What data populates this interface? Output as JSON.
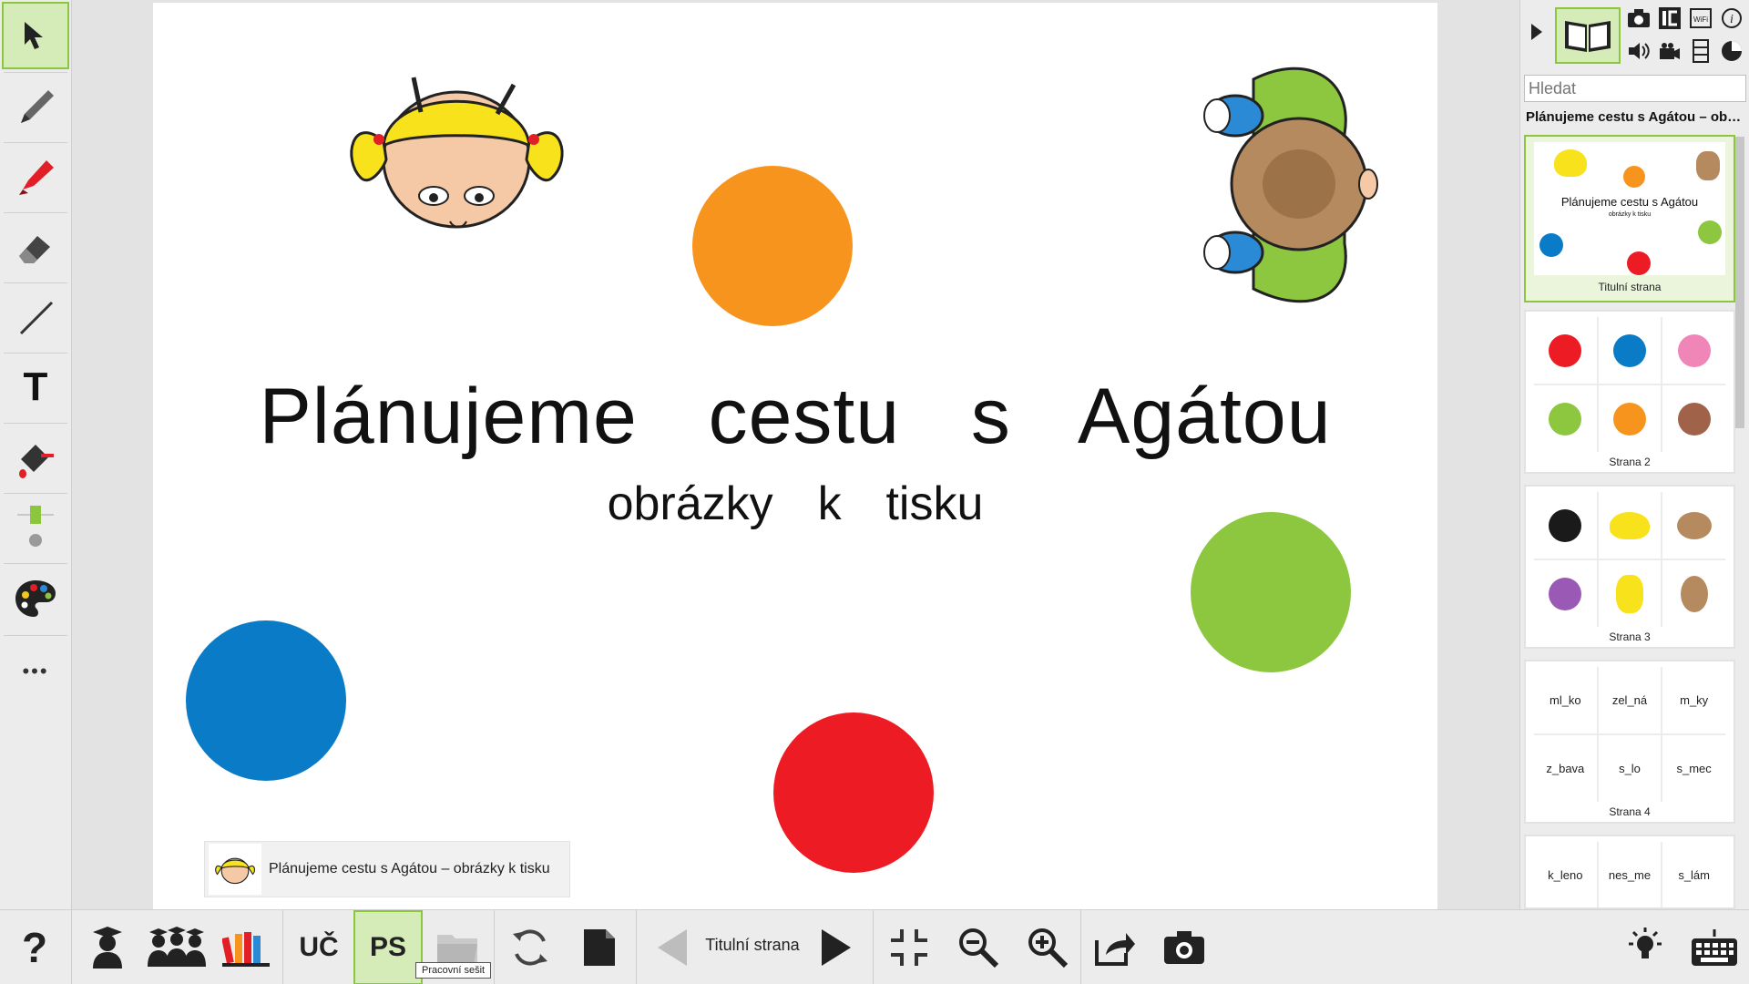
{
  "left_toolbar": {
    "tools": [
      {
        "name": "select",
        "icon": "cursor-arrow-icon",
        "active": true
      },
      {
        "name": "pencil",
        "icon": "pencil-icon"
      },
      {
        "name": "marker",
        "icon": "highlighter-icon"
      },
      {
        "name": "eraser",
        "icon": "eraser-icon"
      },
      {
        "name": "line",
        "icon": "line-icon"
      },
      {
        "name": "text",
        "icon": "text-icon",
        "label": "T"
      },
      {
        "name": "fill",
        "icon": "paint-bucket-icon"
      },
      {
        "name": "line-width",
        "icon": "line-width-icon"
      },
      {
        "name": "colors",
        "icon": "palette-icon"
      },
      {
        "name": "more",
        "icon": "more-dots-icon",
        "label": "•••"
      }
    ],
    "accent": "#8cc63f"
  },
  "slide": {
    "title": "Plánujeme  cestu  s  Agátou",
    "subtitle": "obrázky  k  tisku",
    "dot_colors": {
      "orange": "#f7941d",
      "green": "#8dc63f",
      "blue": "#0a7cc7",
      "red": "#ed1c24"
    },
    "doc_chip_label": "Plánujeme cestu s Agátou – obrázky k tisku"
  },
  "right_panel": {
    "top_icons": [
      "camera-icon",
      "ic-icon",
      "wifi-card-icon",
      "info-icon",
      "speaker-icon",
      "video-camera-icon",
      "film-icon",
      "pie-chart-icon"
    ],
    "search_placeholder": "Hledat",
    "document_title": "Plánujeme cestu s Agátou – obrázky k tisku",
    "thumbnails": [
      {
        "caption": "Titulní strana",
        "mini_title": "Plánujeme cestu s Agátou",
        "mini_subtitle": "obrázky k tisku"
      },
      {
        "caption": "Strana 2",
        "colors": [
          "#ed1c24",
          "#0a7cc7",
          "#f085b7",
          "#8dc63f",
          "#f7941d",
          "#a0634a"
        ]
      },
      {
        "caption": "Strana 3",
        "colors": [
          "#1a1a1a",
          "girl",
          "boy",
          "#9b59b6",
          "girl",
          "boy"
        ]
      },
      {
        "caption": "Strana 4",
        "words": [
          "ml_ko",
          "zel_ná",
          "m_ky",
          "z_bava",
          "s_lo",
          "s_mec"
        ]
      },
      {
        "caption": "",
        "words": [
          "k_leno",
          "nes_me",
          "s_lám"
        ]
      }
    ]
  },
  "bottom_toolbar": {
    "help": "?",
    "uc_label": "UČ",
    "ps_label": "PS",
    "page_label": "Titulní strana",
    "tooltip": "Pracovní sešit",
    "icons": [
      "help-icon",
      "teacher-icon",
      "students-icon",
      "books-icon",
      "folder-icon",
      "refresh-icon",
      "page-icon",
      "prev-page-icon",
      "next-page-icon",
      "fit-screen-icon",
      "zoom-out-icon",
      "zoom-in-icon",
      "export-icon",
      "camera-icon",
      "light-bulb-icon",
      "keyboard-icon"
    ]
  }
}
